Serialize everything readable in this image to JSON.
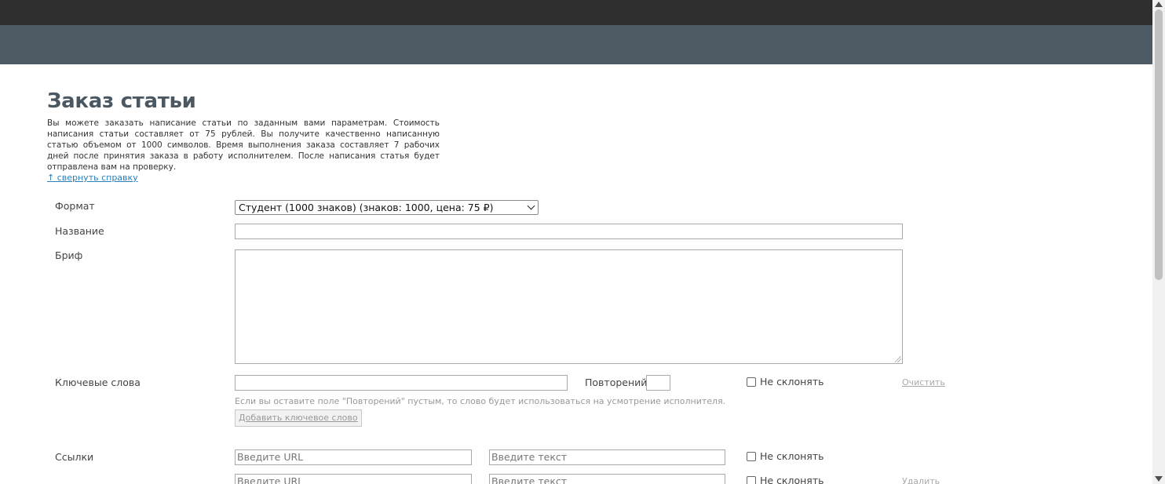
{
  "page": {
    "title": "Заказ статьи",
    "intro": "Вы можете заказать написание статьи по заданным вами параметрам. Стоимость написания статьи составляет от 75 рублей. Вы получите качественно написанную статью объемом от 1000 символов. Время выполнения заказа составляет 7 рабочих дней после принятия заказа в работу исполнителем. После написания статья будет отправлена вам на проверку.",
    "toggle_help": "↑ свернуть справку"
  },
  "form": {
    "format": {
      "label": "Формат",
      "selected": "Студент (1000 знаков) (знаков: 1000, цена: 75 ₽)"
    },
    "name": {
      "label": "Название",
      "value": ""
    },
    "brief": {
      "label": "Бриф",
      "value": ""
    },
    "keywords": {
      "label": "Ключевые слова",
      "value": "",
      "repeat_label": "Повторений",
      "repeat_value": "",
      "no_decline_label": "Не склонять",
      "clear_label": "Очистить",
      "hint": "Если вы оставите поле \"Повторений\" пустым, то слово будет использоваться на усмотрение исполнителя.",
      "add_label": "Добавить ключевое слово"
    },
    "links": {
      "label": "Ссылки",
      "rows": [
        {
          "url_placeholder": "Введите URL",
          "text_placeholder": "Введите текст",
          "no_decline_label": "Не склонять",
          "remove_label": ""
        },
        {
          "url_placeholder": "Введите URL",
          "text_placeholder": "Введите текст",
          "no_decline_label": "Не склонять",
          "remove_label": "Удалить"
        }
      ]
    }
  }
}
